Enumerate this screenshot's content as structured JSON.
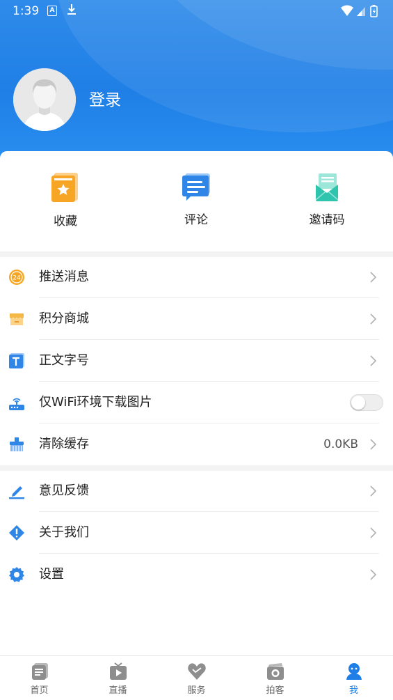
{
  "status_bar": {
    "time": "1:39",
    "notification_a": "A"
  },
  "profile": {
    "login_label": "登录"
  },
  "quick_actions": [
    {
      "label": "收藏",
      "icon": "bookmark-star-icon"
    },
    {
      "label": "评论",
      "icon": "comment-icon"
    },
    {
      "label": "邀请码",
      "icon": "invite-envelope-icon"
    }
  ],
  "menu_group1": [
    {
      "label": "推送消息",
      "icon": "push-24-icon"
    },
    {
      "label": "积分商城",
      "icon": "store-icon"
    },
    {
      "label": "正文字号",
      "icon": "text-size-icon"
    },
    {
      "label": "仅WiFi环境下载图片",
      "icon": "router-icon",
      "toggle_on": false
    },
    {
      "label": "清除缓存",
      "icon": "broom-icon",
      "value": "0.0KB"
    }
  ],
  "menu_group2": [
    {
      "label": "意见反馈",
      "icon": "pencil-icon"
    },
    {
      "label": "关于我们",
      "icon": "info-diamond-icon"
    },
    {
      "label": "设置",
      "icon": "gear-icon"
    }
  ],
  "tab_bar": {
    "tabs": [
      {
        "label": "首页",
        "icon": "home-news-icon"
      },
      {
        "label": "直播",
        "icon": "tv-live-icon"
      },
      {
        "label": "服务",
        "icon": "heart-hands-icon"
      },
      {
        "label": "拍客",
        "icon": "camera-icon"
      },
      {
        "label": "我",
        "icon": "user-icon"
      }
    ],
    "active_index": 4
  },
  "colors": {
    "accent": "#1f7fe6",
    "header_top": "#2f8bea",
    "favorite_orange": "#f7a524",
    "invite_teal": "#2fc4ad"
  }
}
